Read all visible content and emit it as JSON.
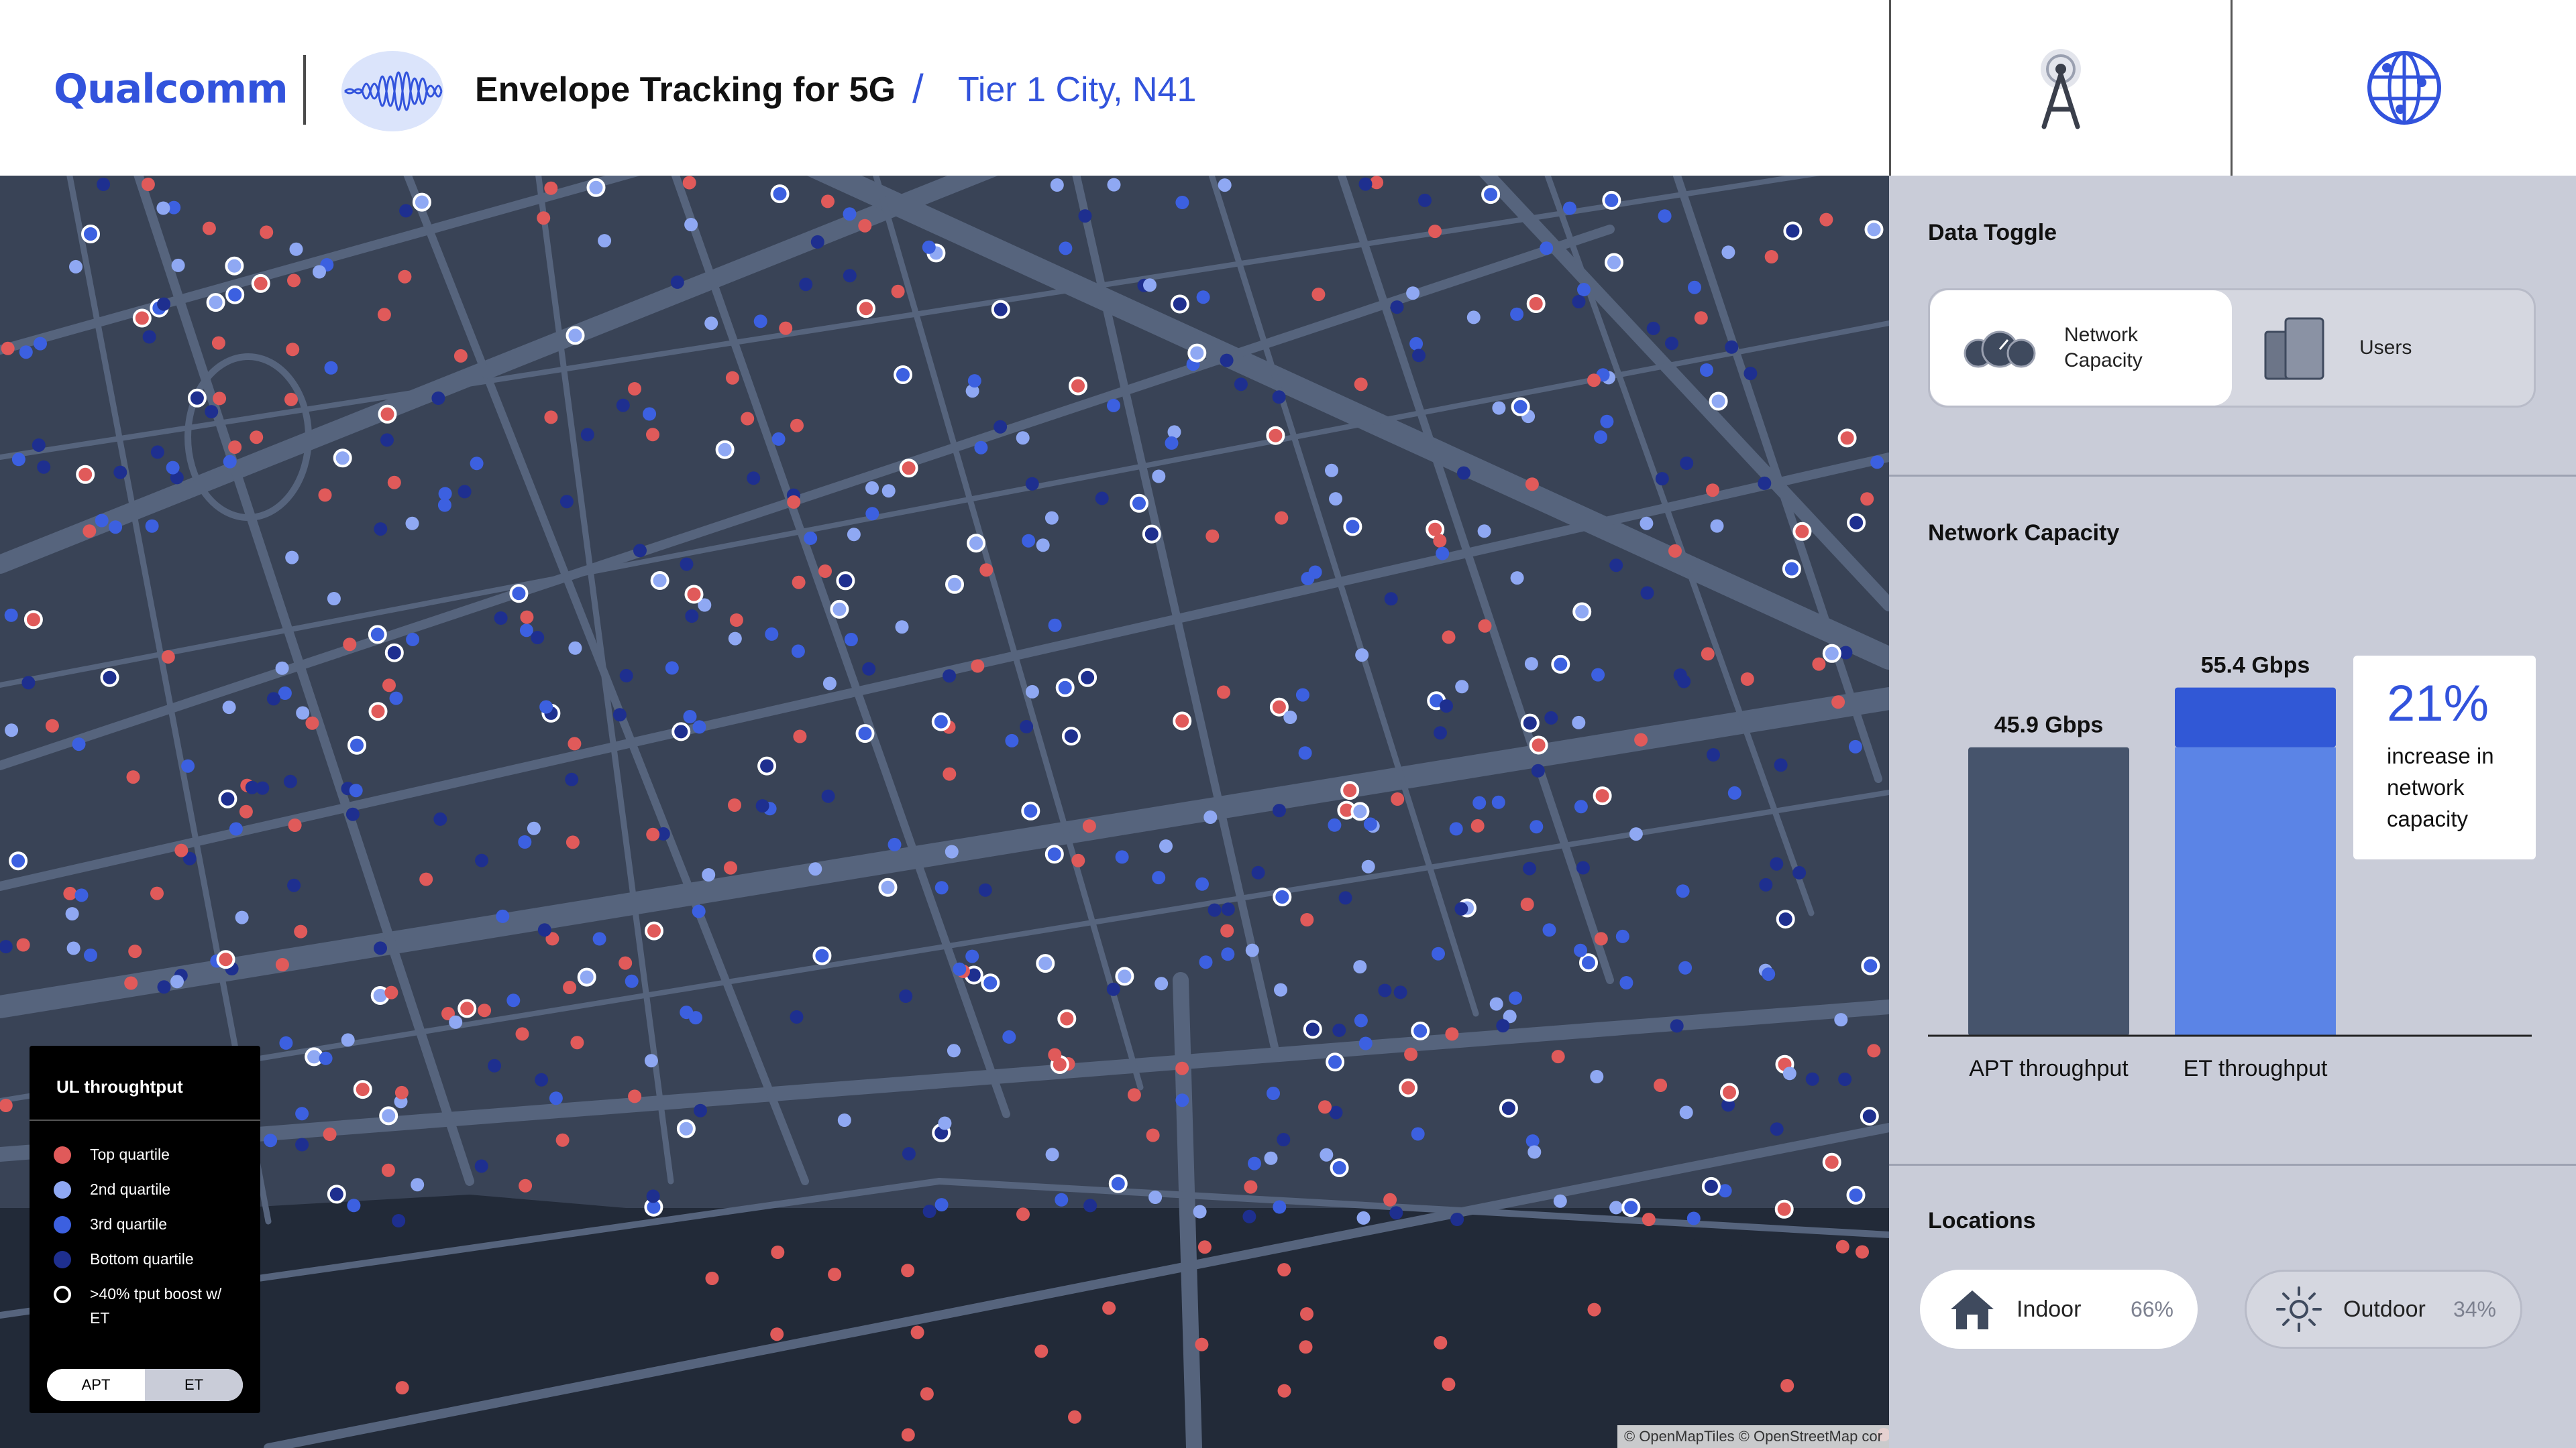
{
  "header": {
    "logo": "Qualcomm",
    "app_title": "Envelope Tracking for 5G",
    "separator": "/",
    "location": "Tier 1 City, N41"
  },
  "top_icons": [
    {
      "name": "tower-icon"
    },
    {
      "name": "globe-icon"
    }
  ],
  "map": {
    "attribution": "© OpenMapTiles © OpenStreetMap cor",
    "colors": {
      "background": "#394356",
      "roads": "#56647d",
      "water": "#222a38"
    }
  },
  "legend": {
    "title": "UL throughtput",
    "items": [
      {
        "label": "Top quartile",
        "color": "#e05a5a"
      },
      {
        "label": "2nd quartile",
        "color": "#8fa8f3"
      },
      {
        "label": "3rd quartile",
        "color": "#3c60e0"
      },
      {
        "label": "Bottom quartile",
        "color": "#1e2f8f"
      },
      {
        "label": ">40% tput boost w/ ET",
        "color": "outline"
      }
    ],
    "toggle": {
      "options": [
        "APT",
        "ET"
      ],
      "selected": "APT"
    }
  },
  "sidebar": {
    "data_toggle": {
      "title": "Data Toggle",
      "options": [
        {
          "label": "Network Capacity",
          "icon": "gauges-icon",
          "selected": true
        },
        {
          "label": "Users",
          "icon": "devices-icon",
          "selected": false
        }
      ]
    },
    "network_capacity": {
      "title": "Network Capacity"
    },
    "callout": {
      "value": "21%",
      "text": "increase in network capacity"
    },
    "locations": {
      "title": "Locations",
      "items": [
        {
          "label": "Indoor",
          "percent": "66%",
          "icon": "house-icon",
          "selected": true
        },
        {
          "label": "Outdoor",
          "percent": "34%",
          "icon": "sun-icon",
          "selected": false
        }
      ]
    }
  },
  "chart_data": {
    "type": "bar",
    "categories": [
      "APT throughput",
      "ET throughput"
    ],
    "values": [
      45.9,
      55.4
    ],
    "value_labels": [
      "45.9 Gbps",
      "55.4 Gbps"
    ],
    "unit": "Gbps",
    "base_of_et": 45.9,
    "colors": {
      "apt": "#46546c",
      "et_base": "#5b84e6",
      "et_gain": "#3158d6"
    },
    "ylim": [
      0,
      64
    ]
  }
}
